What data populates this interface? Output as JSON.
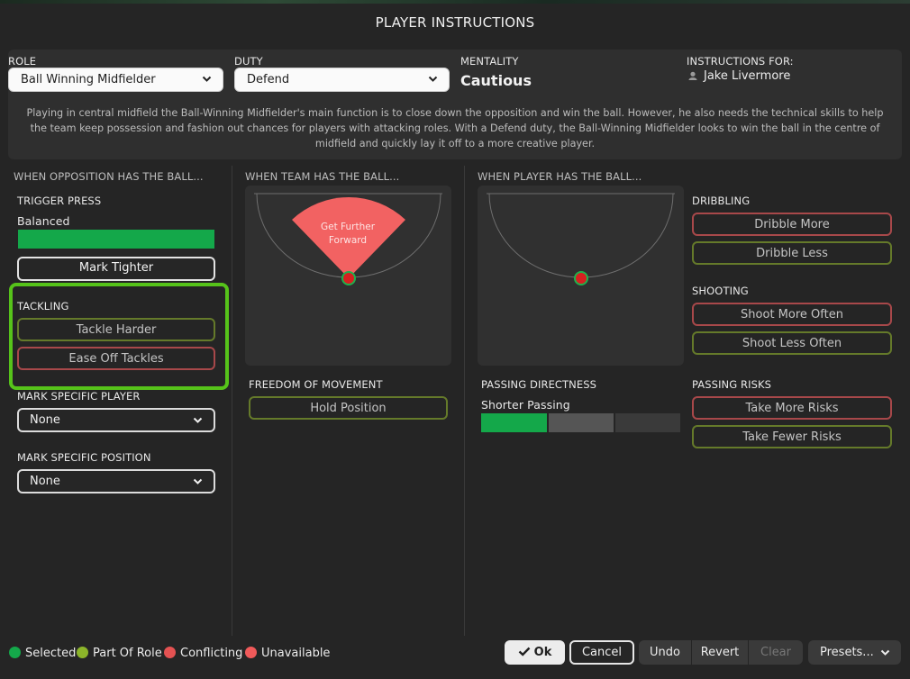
{
  "window": {
    "title": "PLAYER INSTRUCTIONS"
  },
  "header": {
    "role_label": "ROLE",
    "role_value": "Ball Winning Midfielder",
    "duty_label": "DUTY",
    "duty_value": "Defend",
    "mentality_label": "MENTALITY",
    "mentality_value": "Cautious",
    "instructions_for_label": "INSTRUCTIONS FOR:",
    "player_name": "Jake Livermore",
    "description": "Playing in central midfield the Ball-Winning Midfielder's main function is to close down the opposition and win the ball. However, he also needs the technical skills to help the team keep possession and fashion out chances for players with attacking roles. With a Defend duty, the Ball-Winning Midfielder looks to win the ball in the centre of midfield and quickly lay it off to a more creative player."
  },
  "opposition": {
    "header": "WHEN OPPOSITION HAS THE BALL...",
    "trigger_press_label": "TRIGGER PRESS",
    "trigger_press_value": "Balanced",
    "mark_tighter": "Mark Tighter",
    "tackling_label": "TACKLING",
    "tackle_harder": "Tackle Harder",
    "ease_off_tackles": "Ease Off Tackles",
    "mark_player_label": "MARK SPECIFIC PLAYER",
    "mark_player_value": "None",
    "mark_position_label": "MARK SPECIFIC POSITION",
    "mark_position_value": "None"
  },
  "team_ball": {
    "header": "WHEN TEAM HAS THE BALL...",
    "zone_label_1": "Get Further",
    "zone_label_2": "Forward",
    "freedom_label": "FREEDOM OF MOVEMENT",
    "hold_position": "Hold Position"
  },
  "player_ball": {
    "header": "WHEN PLAYER HAS THE BALL...",
    "dribbling_label": "DRIBBLING",
    "dribble_more": "Dribble More",
    "dribble_less": "Dribble Less",
    "shooting_label": "SHOOTING",
    "shoot_more": "Shoot More Often",
    "shoot_less": "Shoot Less Often",
    "passing_directness_label": "PASSING DIRECTNESS",
    "passing_directness_value": "Shorter Passing",
    "passing_risks_label": "PASSING RISKS",
    "take_more_risks": "Take More Risks",
    "take_fewer_risks": "Take Fewer Risks"
  },
  "legend": {
    "selected": "Selected",
    "part_of_role": "Part Of Role",
    "conflicting": "Conflicting",
    "unavailable": "Unavailable"
  },
  "footer": {
    "ok": "Ok",
    "cancel": "Cancel",
    "undo": "Undo",
    "revert": "Revert",
    "clear": "Clear",
    "presets": "Presets..."
  },
  "colors": {
    "selected": "#14a84a",
    "part_of_role": "#8cb52a",
    "conflicting": "#e45252",
    "unavailable": "#f05a5a",
    "highlight": "#56c31a",
    "zone": "#f26262"
  },
  "icons": [
    "chevron-down-icon",
    "person-icon",
    "check-icon",
    "player-marker-icon"
  ]
}
